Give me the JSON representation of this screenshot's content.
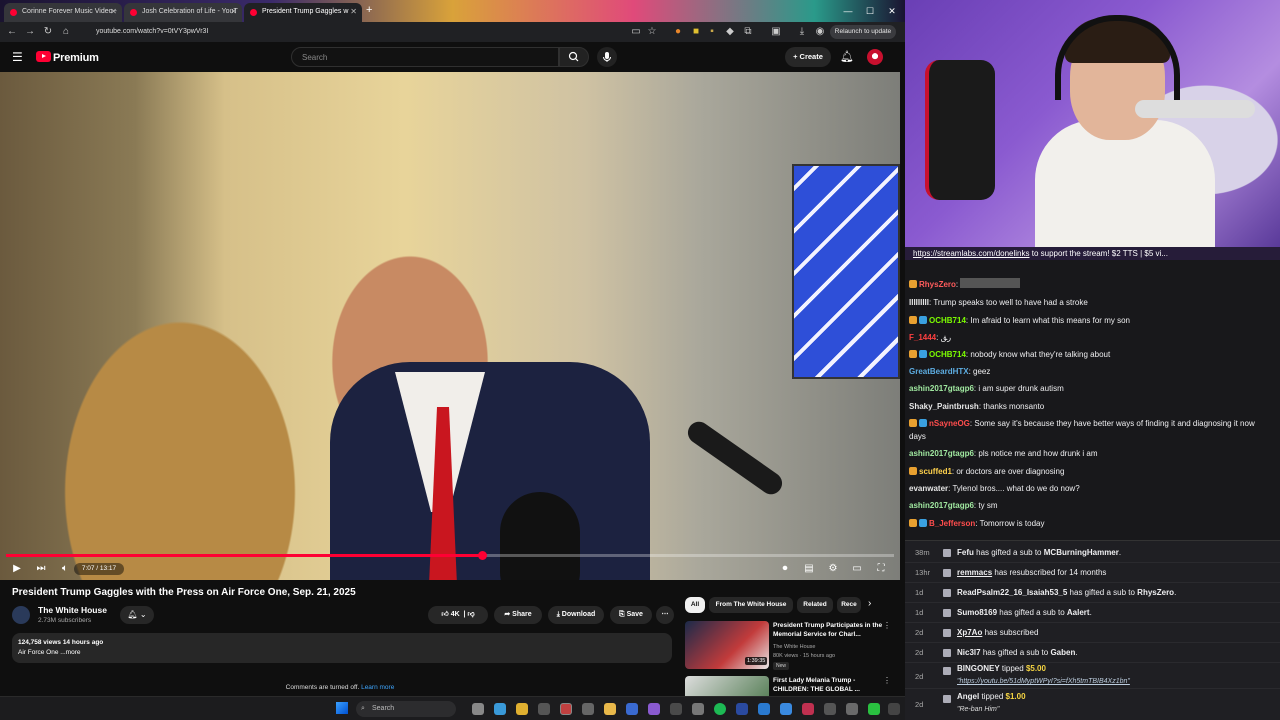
{
  "browser": {
    "tabs": [
      {
        "label": "Corinne Forever Music Video -"
      },
      {
        "label": "Josh Celebration of Life - YouT"
      },
      {
        "label": "President Trump Gaggles w"
      }
    ],
    "url": "youtube.com/watch?v=0tVY3pwVr3I",
    "relaunch_label": "Relaunch to update"
  },
  "youtube": {
    "logo_label": "Premium",
    "search_placeholder": "Search",
    "create_label": "Create",
    "player": {
      "time": "7:07 / 13:17",
      "progress_fraction": 0.536
    },
    "video_title": "President Trump Gaggles with the Press on Air Force One, Sep. 21, 2025",
    "channel": {
      "name": "The White House",
      "subscribers": "2.73M subscribers"
    },
    "like_count": "4K",
    "share_label": "Share",
    "download_label": "Download",
    "save_label": "Save",
    "description": {
      "stats": "124,758 views  14 hours ago",
      "text": "Air Force One ...more"
    },
    "comments_off": "Comments are turned off.",
    "learn_more": "Learn more",
    "chips": [
      {
        "label": "All"
      },
      {
        "label": "From The White House"
      },
      {
        "label": "Related"
      },
      {
        "label": "Rece"
      }
    ],
    "recommendations": [
      {
        "title": "President Trump Participates in the Memorial Service for Charl...",
        "channel": "The White House",
        "meta": "80K views · 15 hours ago",
        "duration": "1:39:35",
        "badge": "New"
      },
      {
        "title": "First Lady Melania Trump - CHILDREN: THE GLOBAL ..."
      }
    ]
  },
  "taskbar": {
    "search_placeholder": "Search"
  },
  "stream": {
    "ticker_link": "https://streamlabs.com/donelinks",
    "ticker_text": " to support the stream! $2 TTS | $5 vi..."
  },
  "chat": [
    {
      "user": "RhysZero",
      "text": "",
      "color": "#ff5c5c"
    },
    {
      "user": "IIIIIIIII",
      "text": "Trump speaks too well to have had a stroke",
      "color": "#e6e6e6"
    },
    {
      "user": "OCHB714",
      "text": "Im afraid to learn what this means for my son",
      "color": "#7cfc00"
    },
    {
      "user": "F_1444",
      "text": "ر‍ق",
      "color": "#ff4040"
    },
    {
      "user": "OCHB714",
      "text": "nobody know what they're talking about",
      "color": "#7cfc00"
    },
    {
      "user": "GreatBeardHTX",
      "text": "geez",
      "color": "#5dade2"
    },
    {
      "user": "ashin2017gtagp6",
      "text": "i am super drunk autism",
      "color": "#a0e8a0"
    },
    {
      "user": "Shaky_Paintbrush",
      "text": "thanks monsanto",
      "color": "#e6e6e6"
    },
    {
      "user": "nSayneOG",
      "text": "Some say it's because they have better ways of finding it and diagnosing it now days",
      "color": "#ff4d4d"
    },
    {
      "user": "ashin2017gtagp6",
      "text": "pls notice me and how drunk i am",
      "color": "#a0e8a0"
    },
    {
      "user": "scuffed1",
      "text": "or doctors are over diagnosing",
      "color": "#ffd24d"
    },
    {
      "user": "evanwater",
      "text": "Tylenol bros.... what do we do now?",
      "color": "#e6e6e6"
    },
    {
      "user": "ashin2017gtagp6",
      "text": "ty sm",
      "color": "#a0e8a0"
    },
    {
      "user": "B_Jefferson",
      "text": "Tomorrow is today",
      "color": "#ff4d4d"
    }
  ],
  "feed": [
    {
      "time": "38m",
      "user": "Fefu",
      "action": "has gifted a sub to",
      "target": "MCBurningHammer",
      "note": ""
    },
    {
      "time": "13hr",
      "user": "remmacs",
      "action": "has resubscribed for 14 months",
      "target": "",
      "note": ""
    },
    {
      "time": "1d",
      "user": "ReadPsalm22_16_Isaiah53_5",
      "action": "has gifted a sub to",
      "target": "RhysZero",
      "note": ""
    },
    {
      "time": "1d",
      "user": "Sumo8169",
      "action": "has gifted a sub to",
      "target": "Aalert",
      "note": ""
    },
    {
      "time": "2d",
      "user": "Xp7Ao",
      "action": "has subscribed",
      "target": "",
      "note": ""
    },
    {
      "time": "2d",
      "user": "Nic3l7",
      "action": "has gifted a sub to",
      "target": "Gaben",
      "note": ""
    },
    {
      "time": "2d",
      "user": "BINGONEY",
      "action": "tipped",
      "target": "$5.00",
      "note": "\"https://youtu.be/51dMyptWPyI?si=fXh5tmTBIB4Xz1bn\""
    },
    {
      "time": "2d",
      "user": "Angel",
      "action": "tipped",
      "target": "$1.00",
      "note": "\"Re-ban Him\""
    }
  ]
}
